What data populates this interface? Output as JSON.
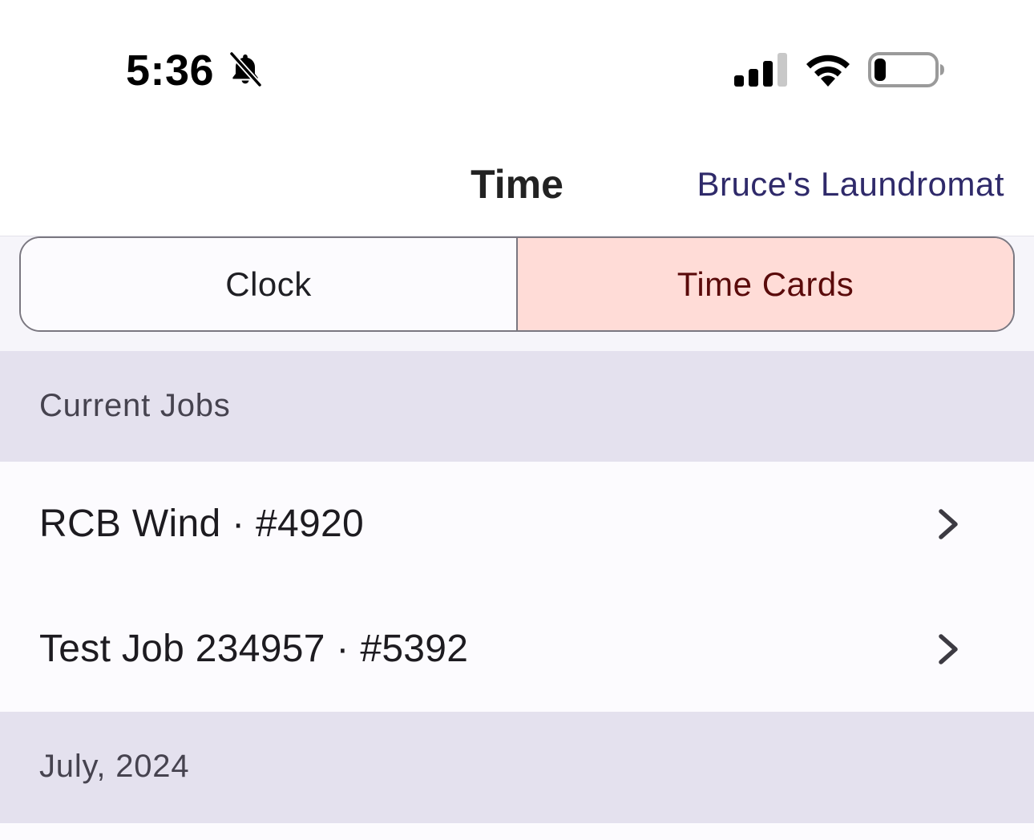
{
  "status_bar": {
    "time": "5:36",
    "icons": [
      "bell-slash-icon",
      "cellular-signal-icon",
      "wifi-icon",
      "battery-icon"
    ],
    "battery_level": 0.2
  },
  "nav": {
    "title": "Time",
    "right_link": "Bruce's Laundromat"
  },
  "segments": {
    "items": [
      {
        "label": "Clock",
        "selected": false
      },
      {
        "label": "Time Cards",
        "selected": true
      }
    ]
  },
  "sections": [
    {
      "header": "Current Jobs",
      "rows": [
        {
          "label": "RCB Wind · #4920"
        },
        {
          "label": "Test Job 234957 · #5392"
        }
      ]
    },
    {
      "header": "July, 2024",
      "rows": []
    }
  ],
  "colors": {
    "accent_link": "#2f2a6a",
    "selected_segment_bg": "#ffdcd7",
    "selected_segment_text": "#5a0a0a",
    "section_header_bg": "#e4e1ee",
    "row_bg": "#fcfbfe"
  }
}
